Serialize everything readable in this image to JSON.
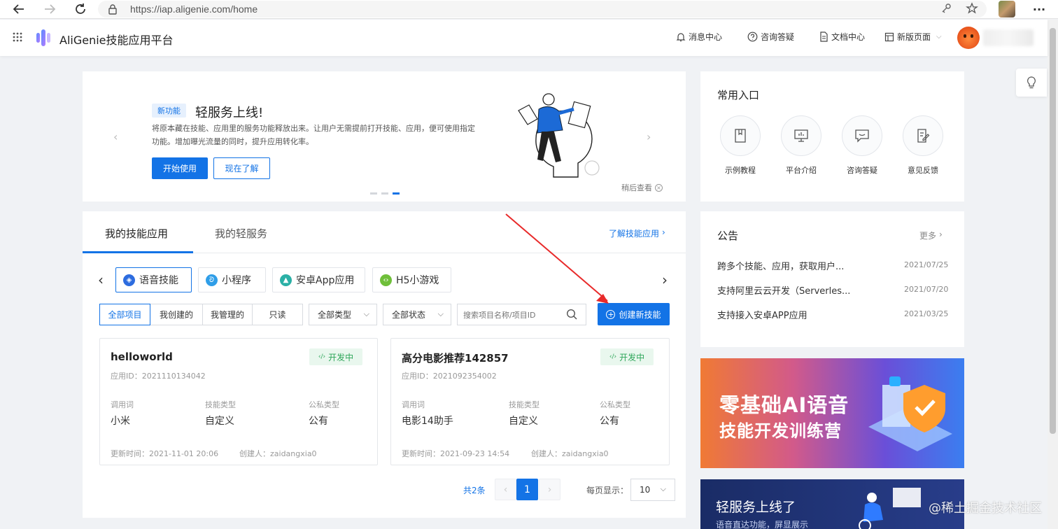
{
  "browser": {
    "url": "https://iap.aligenie.com/home"
  },
  "header": {
    "app_title": "AliGenie技能应用平台",
    "nav": [
      {
        "label": "消息中心",
        "icon": "bell-icon"
      },
      {
        "label": "咨询答疑",
        "icon": "help-circle-icon"
      },
      {
        "label": "文档中心",
        "icon": "document-icon"
      },
      {
        "label": "新版页面",
        "icon": "layout-icon"
      }
    ]
  },
  "banner": {
    "tag": "新功能",
    "title": "轻服务上线!",
    "desc_line1": "将原本藏在技能、应用里的服务功能释放出来。让用户无需提前打开技能、应用，便可使用指定",
    "desc_line2": "功能。增加曝光流量的同时，提升应用转化率。",
    "btn_start": "开始使用",
    "btn_learn": "现在了解",
    "later": "稍后查看"
  },
  "skills": {
    "tabs": [
      "我的技能应用",
      "我的轻服务"
    ],
    "learn_link": "了解技能应用",
    "categories": [
      "语音技能",
      "小程序",
      "安卓App应用",
      "H5小游戏"
    ],
    "filters": [
      "全部项目",
      "我创建的",
      "我管理的",
      "只读"
    ],
    "type_select": "全部类型",
    "status_select": "全部状态",
    "search_placeholder": "搜索项目名称/项目ID",
    "create_btn": "创建新技能",
    "projects": [
      {
        "name": "helloworld",
        "status": "开发中",
        "app_id": "应用ID：2021110134042",
        "col1_label": "调用词",
        "col1_value": "小米",
        "col2_label": "技能类型",
        "col2_value": "自定义",
        "col3_label": "公私类型",
        "col3_value": "公有",
        "updated": "更新时间：2021-11-01 20:06",
        "creator": "创建人：zaidangxia0"
      },
      {
        "name": "高分电影推荐142857",
        "status": "开发中",
        "app_id": "应用ID：2021092354002",
        "col1_label": "调用词",
        "col1_value": "电影14助手",
        "col2_label": "技能类型",
        "col2_value": "自定义",
        "col3_label": "公私类型",
        "col3_value": "公有",
        "updated": "更新时间：2021-09-23 14:54",
        "creator": "创建人：zaidangxia0"
      }
    ],
    "pagination": {
      "total": "共2条",
      "current": "1",
      "per_page_label": "每页显示：",
      "per_page": "10"
    }
  },
  "quick": {
    "title": "常用入口",
    "items": [
      {
        "label": "示例教程",
        "icon": "book-icon"
      },
      {
        "label": "平台介绍",
        "icon": "monitor-icon"
      },
      {
        "label": "咨询答疑",
        "icon": "chat-icon"
      },
      {
        "label": "意见反馈",
        "icon": "feedback-icon"
      }
    ]
  },
  "notices": {
    "title": "公告",
    "more": "更多",
    "items": [
      {
        "text": "跨多个技能、应用，获取用户...",
        "date": "2021/07/25"
      },
      {
        "text": "支持阿里云云开发（Serverles...",
        "date": "2021/07/20"
      },
      {
        "text": "支持接入安卓APP应用",
        "date": "2021/03/25"
      }
    ]
  },
  "promo1": {
    "line1": "零基础AI语音",
    "line2": "技能开发训练营"
  },
  "promo2": {
    "title": "轻服务上线了",
    "sub": "语音直达功能，屏显展示"
  },
  "watermark": "@稀土掘金技术社区",
  "colors": {
    "primary": "#1373e6",
    "success": "#2ea65a",
    "annotation_arrow": "#e82a2a"
  }
}
